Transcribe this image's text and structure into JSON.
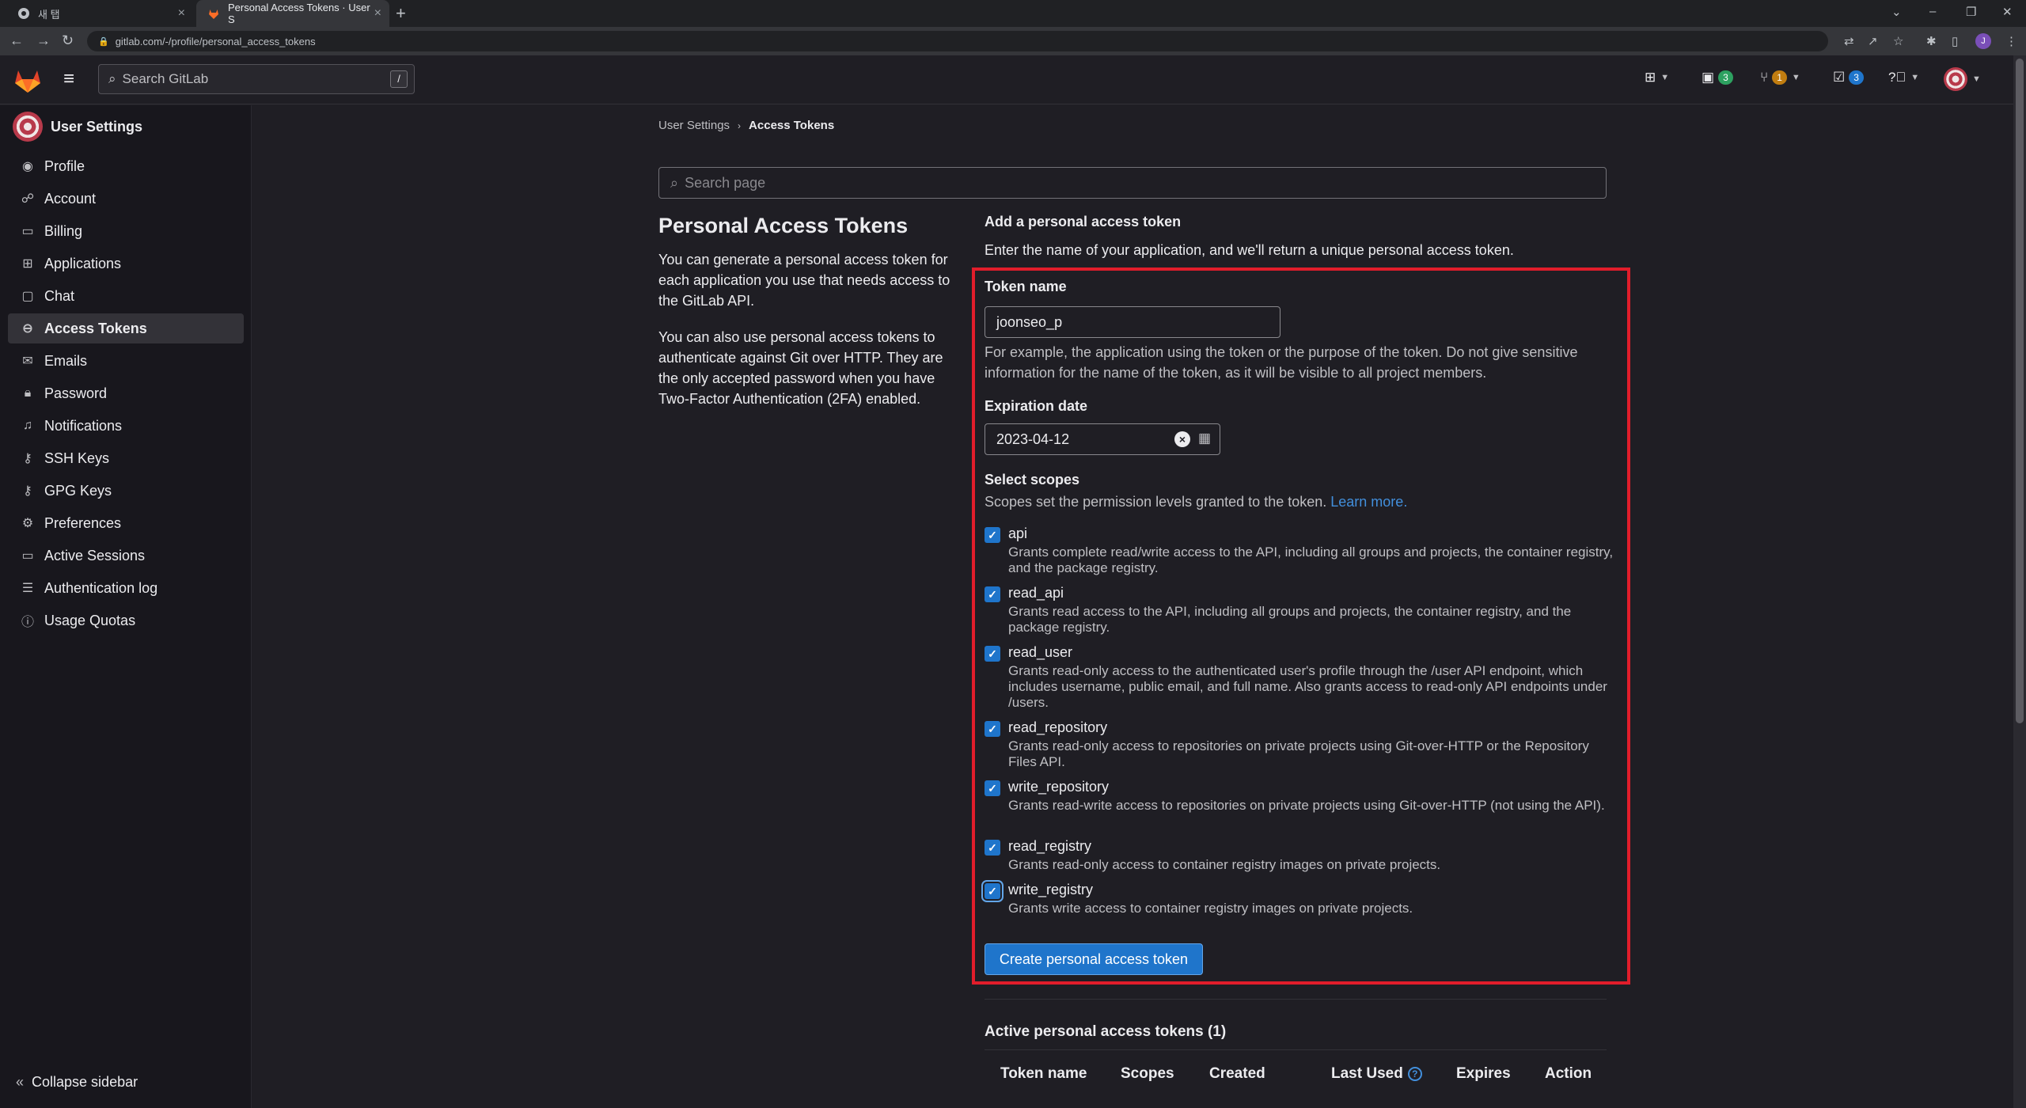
{
  "browser": {
    "tabs": [
      {
        "title": "새 탭"
      },
      {
        "title": "Personal Access Tokens · User S"
      }
    ],
    "url": "gitlab.com/-/profile/personal_access_tokens",
    "profile_initial": "J"
  },
  "topbar": {
    "search_placeholder": "Search GitLab",
    "search_shortcut": "/",
    "issues_count": "3",
    "merge_requests_count": "1",
    "todos_count": "3",
    "colors": {
      "green_badge": "#2da160",
      "orange_badge": "#c17d10",
      "blue_badge": "#1f75cb"
    }
  },
  "sidebar": {
    "title": "User Settings",
    "items": [
      {
        "label": "Profile",
        "icon": "profile-icon"
      },
      {
        "label": "Account",
        "icon": "account-icon"
      },
      {
        "label": "Billing",
        "icon": "billing-icon"
      },
      {
        "label": "Applications",
        "icon": "applications-icon"
      },
      {
        "label": "Chat",
        "icon": "chat-icon"
      },
      {
        "label": "Access Tokens",
        "icon": "token-icon",
        "active": true
      },
      {
        "label": "Emails",
        "icon": "mail-icon"
      },
      {
        "label": "Password",
        "icon": "lock-icon"
      },
      {
        "label": "Notifications",
        "icon": "bell-icon"
      },
      {
        "label": "SSH Keys",
        "icon": "key-icon"
      },
      {
        "label": "GPG Keys",
        "icon": "key-icon"
      },
      {
        "label": "Preferences",
        "icon": "preferences-icon"
      },
      {
        "label": "Active Sessions",
        "icon": "monitor-icon"
      },
      {
        "label": "Authentication log",
        "icon": "log-icon"
      },
      {
        "label": "Usage Quotas",
        "icon": "quota-icon"
      }
    ],
    "collapse_label": "Collapse sidebar"
  },
  "breadcrumb": {
    "parent": "User Settings",
    "current": "Access Tokens"
  },
  "page_search_placeholder": "Search page",
  "intro": {
    "title": "Personal Access Tokens",
    "p1": "You can generate a personal access token for each application you use that needs access to the GitLab API.",
    "p2": "You can also use personal access tokens to authenticate against Git over HTTP. They are the only accepted password when you have Two-Factor Authentication (2FA) enabled."
  },
  "form": {
    "section_title": "Add a personal access token",
    "section_desc": "Enter the name of your application, and we'll return a unique personal access token.",
    "token_name_label": "Token name",
    "token_name_value": "joonseo_p",
    "token_name_hint": "For example, the application using the token or the purpose of the token. Do not give sensitive information for the name of the token, as it will be visible to all project members.",
    "expiration_label": "Expiration date",
    "expiration_value": "2023-04-12",
    "scopes_label": "Select scopes",
    "scopes_hint": "Scopes set the permission levels granted to the token.",
    "learn_more": "Learn more.",
    "scopes": [
      {
        "name": "api",
        "checked": true,
        "desc": "Grants complete read/write access to the API, including all groups and projects, the container registry, and the package registry."
      },
      {
        "name": "read_api",
        "checked": true,
        "desc": "Grants read access to the API, including all groups and projects, the container registry, and the package registry."
      },
      {
        "name": "read_user",
        "checked": true,
        "desc": "Grants read-only access to the authenticated user's profile through the /user API endpoint, which includes username, public email, and full name. Also grants access to read-only API endpoints under /users."
      },
      {
        "name": "read_repository",
        "checked": true,
        "desc": "Grants read-only access to repositories on private projects using Git-over-HTTP or the Repository Files API."
      },
      {
        "name": "write_repository",
        "checked": true,
        "desc": "Grants read-write access to repositories on private projects using Git-over-HTTP (not using the API)."
      },
      {
        "name": "read_registry",
        "checked": true,
        "desc": "Grants read-only access to container registry images on private projects."
      },
      {
        "name": "write_registry",
        "checked": true,
        "desc": "Grants write access to container registry images on private projects."
      }
    ],
    "submit_label": "Create personal access token"
  },
  "active_tokens": {
    "title": "Active personal access tokens (1)",
    "columns": [
      "Token name",
      "Scopes",
      "Created",
      "Last Used",
      "Expires",
      "Action"
    ]
  },
  "accent_color": "#1f75cb",
  "highlight_color": "#e11d2b"
}
